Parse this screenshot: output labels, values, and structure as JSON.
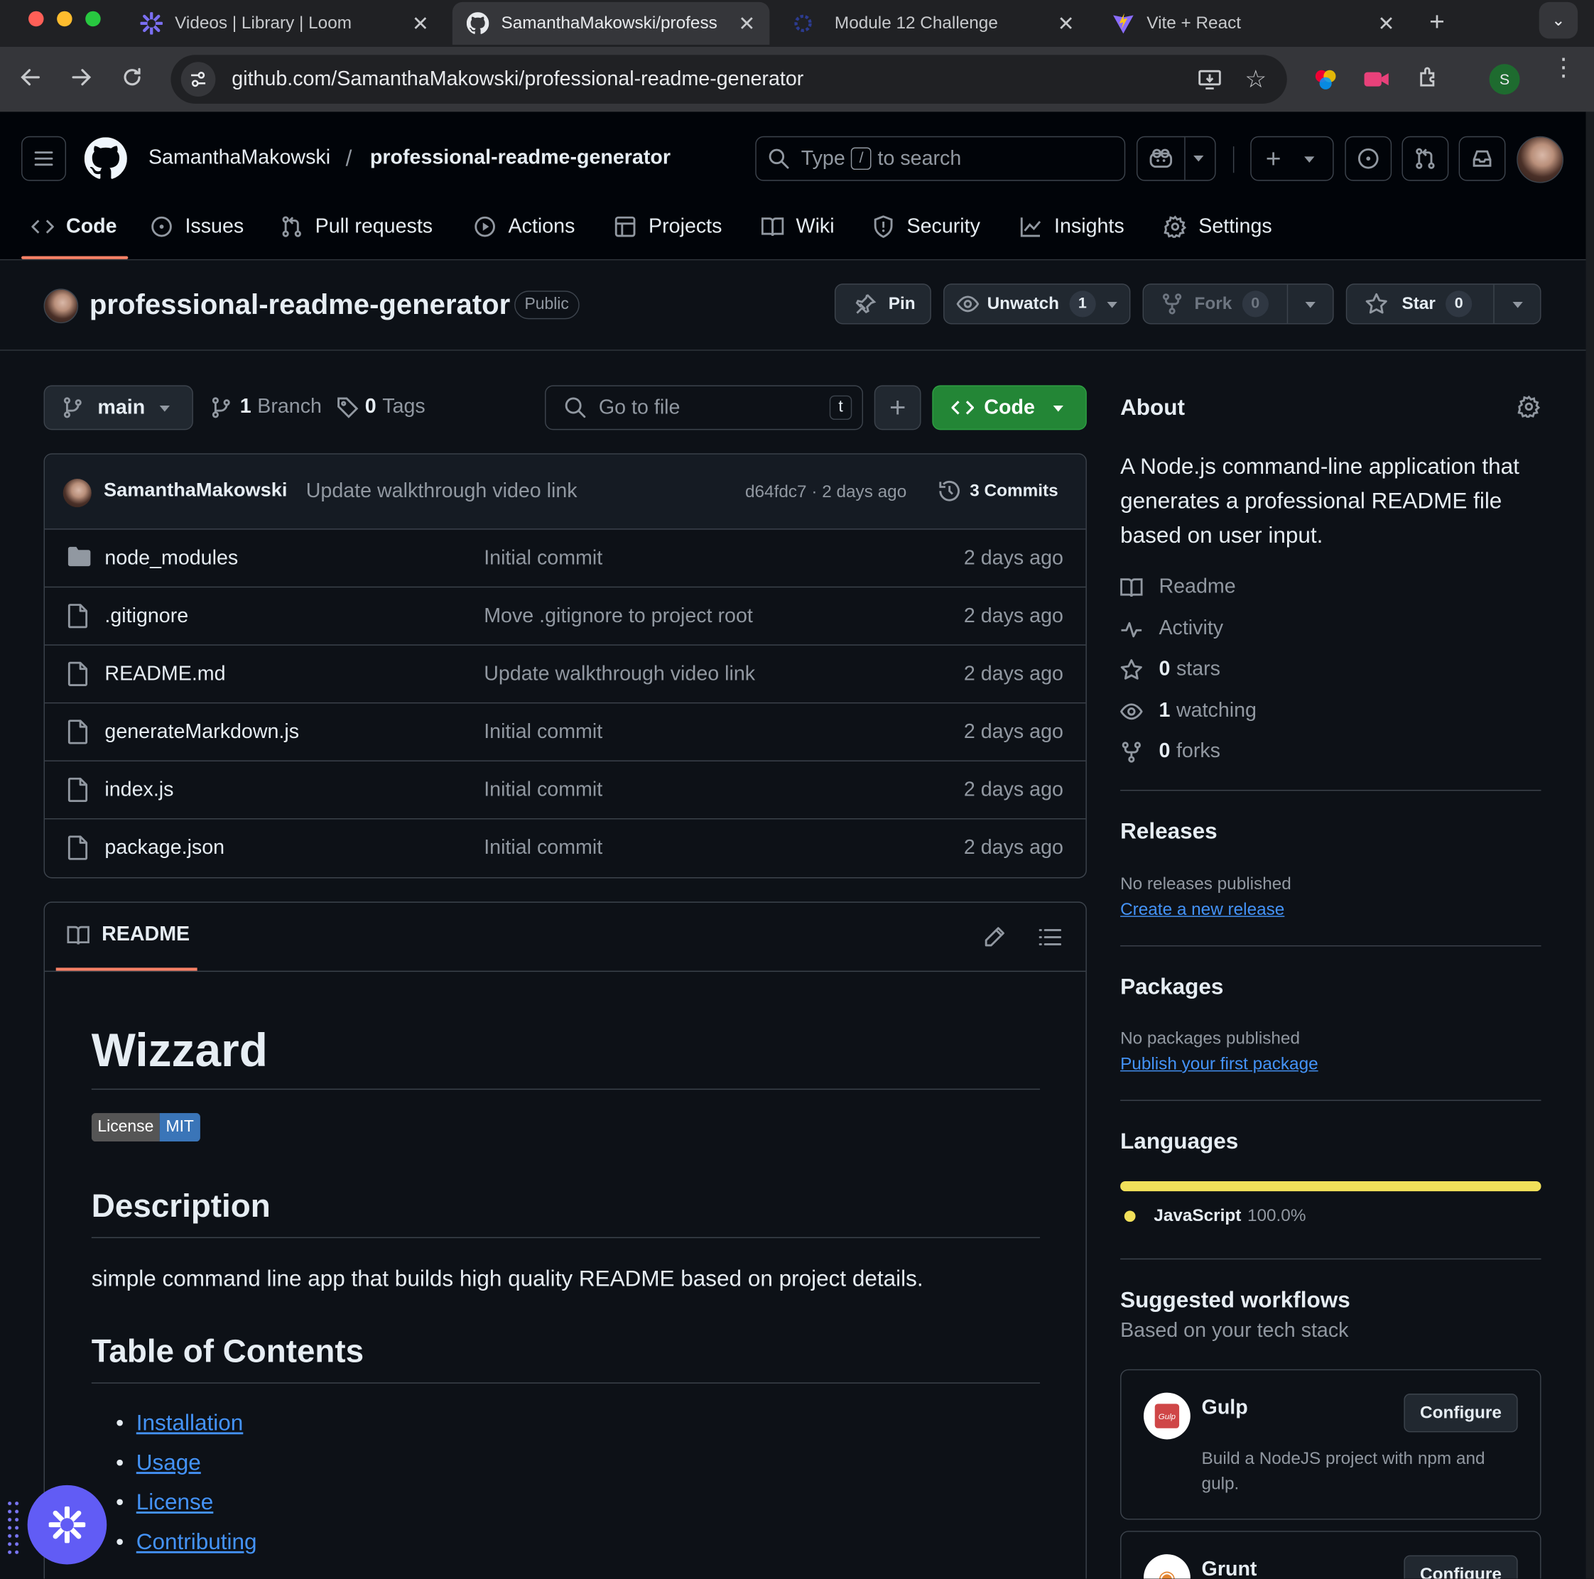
{
  "browser": {
    "tabs": [
      {
        "title": "Videos | Library | Loom"
      },
      {
        "title": "SamanthaMakowski/profess"
      },
      {
        "title": "Module 12 Challenge"
      },
      {
        "title": "Vite + React"
      }
    ],
    "url": "github.com/SamanthaMakowski/professional-readme-generator",
    "profile_initial": "S"
  },
  "header": {
    "owner": "SamanthaMakowski",
    "separator": "/",
    "repo": "professional-readme-generator",
    "search_type": "Type",
    "search_key": "/",
    "search_suffix": "to search"
  },
  "nav": {
    "tabs": [
      "Code",
      "Issues",
      "Pull requests",
      "Actions",
      "Projects",
      "Wiki",
      "Security",
      "Insights",
      "Settings"
    ]
  },
  "repo": {
    "name": "professional-readme-generator",
    "visibility": "Public",
    "pin": "Pin",
    "unwatch": "Unwatch",
    "watch_count": "1",
    "fork": "Fork",
    "fork_count": "0",
    "star": "Star",
    "star_count": "0"
  },
  "browser_bar": {
    "branch": "main",
    "branch_count": "1",
    "branch_label": "Branch",
    "tag_count": "0",
    "tag_label": "Tags",
    "goto_placeholder": "Go to file",
    "goto_key": "t",
    "code_button": "Code"
  },
  "commit": {
    "author": "SamanthaMakowski",
    "message": "Update walkthrough video link",
    "hash_time": "d64fdc7 · 2 days ago",
    "commits": "3 Commits"
  },
  "files": [
    {
      "name": "node_modules",
      "type": "folder",
      "message": "Initial commit",
      "date": "2 days ago"
    },
    {
      "name": ".gitignore",
      "type": "file",
      "message": "Move .gitignore to project root",
      "date": "2 days ago"
    },
    {
      "name": "README.md",
      "type": "file",
      "message": "Update walkthrough video link",
      "date": "2 days ago"
    },
    {
      "name": "generateMarkdown.js",
      "type": "file",
      "message": "Initial commit",
      "date": "2 days ago"
    },
    {
      "name": "index.js",
      "type": "file",
      "message": "Initial commit",
      "date": "2 days ago"
    },
    {
      "name": "package.json",
      "type": "file",
      "message": "Initial commit",
      "date": "2 days ago"
    }
  ],
  "readme": {
    "tab": "README",
    "title": "Wizzard",
    "badge_left": "License",
    "badge_right": "MIT",
    "description_heading": "Description",
    "description": "simple command line app that builds high quality README based on project details.",
    "toc_heading": "Table of Contents",
    "toc": [
      "Installation",
      "Usage",
      "License",
      "Contributing"
    ]
  },
  "about": {
    "heading": "About",
    "description": "A Node.js command-line application that generates a professional README file based on user input.",
    "readme": "Readme",
    "activity": "Activity",
    "stars_n": "0",
    "stars": "stars",
    "watching_n": "1",
    "watching": "watching",
    "forks_n": "0",
    "forks": "forks"
  },
  "releases": {
    "heading": "Releases",
    "none": "No releases published",
    "link": "Create a new release"
  },
  "packages": {
    "heading": "Packages",
    "none": "No packages published",
    "link": "Publish your first package"
  },
  "languages": {
    "heading": "Languages",
    "items": [
      {
        "name": "JavaScript",
        "percent": "100.0%",
        "fraction": 1.0,
        "color": "#f1e05a"
      }
    ]
  },
  "workflows": {
    "heading": "Suggested workflows",
    "subheading": "Based on your tech stack",
    "items": [
      {
        "name": "Gulp",
        "button": "Configure",
        "description": "Build a NodeJS project with npm and gulp."
      },
      {
        "name": "Grunt",
        "button": "Configure"
      }
    ]
  },
  "colors": {
    "accent_green": "#238636",
    "link_blue": "#4493f8",
    "tab_underline": "#f78166",
    "bg": "#0d1117"
  }
}
